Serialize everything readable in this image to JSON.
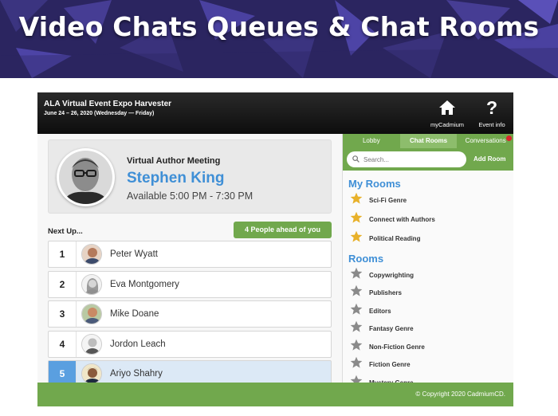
{
  "slide": {
    "title": "Video Chats Queues & Chat Rooms"
  },
  "header": {
    "event_name": "ALA Virtual Event Expo Harvester",
    "event_dates": "June 24 – 26, 2020 (Wednesday — Friday)",
    "my_cadmium_label": "myCadmium",
    "event_info_label": "Event info",
    "event_info_glyph": "?"
  },
  "meeting": {
    "label": "Virtual Author Meeting",
    "author": "Stephen King",
    "availability": "Available 5:00 PM - 7:30 PM"
  },
  "queue": {
    "next_up_label": "Next Up...",
    "ahead_badge": "4 People ahead of you",
    "rows": [
      {
        "position": "1",
        "name": "Peter Wyatt"
      },
      {
        "position": "2",
        "name": "Eva Montgomery"
      },
      {
        "position": "3",
        "name": "Mike Doane"
      },
      {
        "position": "4",
        "name": "Jordon Leach"
      },
      {
        "position": "5",
        "name": "Ariyo Shahry"
      }
    ],
    "active_position": "5"
  },
  "sidebar": {
    "tabs": [
      {
        "label": "Lobby"
      },
      {
        "label": "Chat Rooms"
      },
      {
        "label": "Conversations"
      }
    ],
    "selected_tab": "Chat Rooms",
    "search_placeholder": "Search...",
    "add_room_label": "Add Room",
    "my_rooms_title": "My Rooms",
    "my_rooms": [
      "Sci-Fi Genre",
      "Connect with Authors",
      "Political Reading"
    ],
    "rooms_title": "Rooms",
    "rooms": [
      "Copywrighting",
      "Publishers",
      "Editors",
      "Fantasy Genre",
      "Non-Fiction Genre",
      "Fiction Genre",
      "Mystery Genre"
    ]
  },
  "footer": {
    "copyright": "© Copyright 2020 CadmiumCD."
  },
  "colors": {
    "banner": "#2b2560",
    "accent_green": "#71a84d",
    "accent_blue": "#3f8fd6",
    "active_blue": "#5a9fe0",
    "star_gold": "#e8b12a",
    "star_gray": "#8a8a8a"
  },
  "icons": {
    "my_cadmium": "home-icon",
    "event_info": "question-icon",
    "search": "search-icon",
    "my_room": "star-gold-icon",
    "room": "star-gray-icon"
  }
}
